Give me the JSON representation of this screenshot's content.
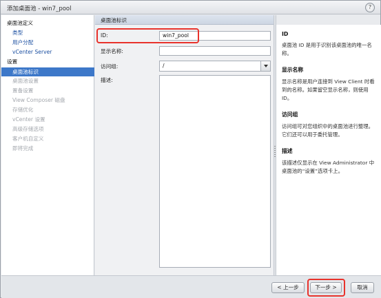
{
  "window": {
    "title": "添加桌面池 - win7_pool",
    "help": "?"
  },
  "sidebar": {
    "items": [
      {
        "label": "桌面池定义"
      },
      {
        "label": "类型"
      },
      {
        "label": "用户分配"
      },
      {
        "label": "vCenter Server"
      },
      {
        "label": "设置"
      },
      {
        "label": "桌面池标识"
      },
      {
        "label": "桌面池设置"
      },
      {
        "label": "置备设置"
      },
      {
        "label": "View Composer 磁盘"
      },
      {
        "label": "存储优化"
      },
      {
        "label": "vCenter 设置"
      },
      {
        "label": "高级存储选项"
      },
      {
        "label": "客户机自定义"
      },
      {
        "label": "即将完成"
      }
    ]
  },
  "main": {
    "header": "桌面池标识",
    "id_label": "ID:",
    "id_value": "win7_pool",
    "display_name_label": "显示名称:",
    "display_name_value": "",
    "access_group_label": "访问组:",
    "access_group_value": "/",
    "description_label": "描述:"
  },
  "help": {
    "sections": [
      {
        "title": "ID",
        "text": "桌面池 ID 是用于识别该桌面池的唯一名称。"
      },
      {
        "title": "显示名称",
        "text": "显示名称是用户连接到 View Client 时看到的名称。如果留空显示名称，则使用 ID。"
      },
      {
        "title": "访问组",
        "text": "访问组可对您组织中的桌面池进行整理。它们还可以用于委托管理。"
      },
      {
        "title": "描述",
        "text": "该描述仅显示在 View Administrator 中桌面池的“设置”选项卡上。"
      }
    ]
  },
  "footer": {
    "back": "< 上一步",
    "next": "下一步 >",
    "cancel": "取消"
  },
  "colors": {
    "highlight": "#e8322b",
    "active": "#3d78c9",
    "link": "#1a4ea0"
  }
}
